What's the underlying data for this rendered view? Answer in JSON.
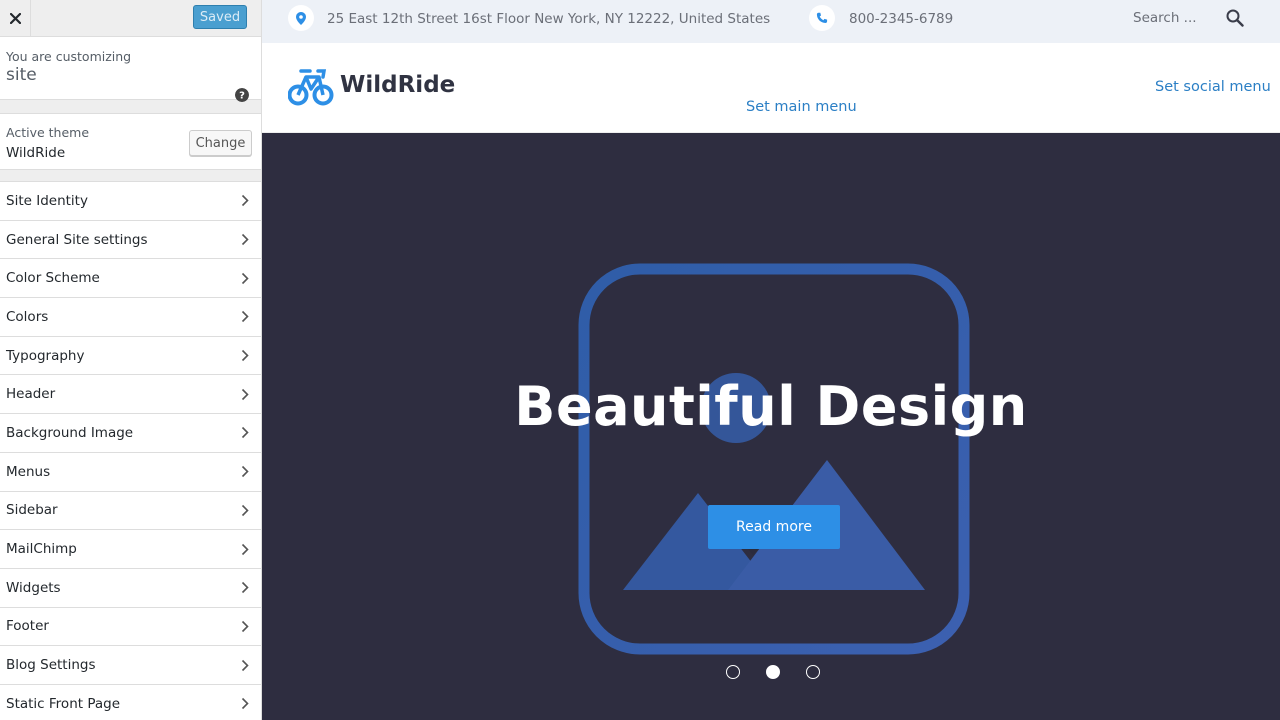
{
  "customizer": {
    "saved_label": "Saved",
    "customizing_label": "You are customizing",
    "customizing_target": "site",
    "active_theme_label": "Active theme",
    "active_theme_name": "WildRide",
    "change_label": "Change",
    "sections": [
      {
        "label": "Site Identity"
      },
      {
        "label": "General Site settings"
      },
      {
        "label": "Color Scheme"
      },
      {
        "label": "Colors"
      },
      {
        "label": "Typography"
      },
      {
        "label": "Header"
      },
      {
        "label": "Background Image"
      },
      {
        "label": "Menus"
      },
      {
        "label": "Sidebar"
      },
      {
        "label": "MailChimp"
      },
      {
        "label": "Widgets"
      },
      {
        "label": "Footer"
      },
      {
        "label": "Blog Settings"
      },
      {
        "label": "Static Front Page"
      }
    ]
  },
  "site": {
    "address": "25 East 12th Street 16st Floor New York, NY 12222, United States",
    "phone": "800-2345-6789",
    "search_placeholder": "Search ...",
    "logo_text": "WildRide",
    "main_menu_link": "Set main menu",
    "social_menu_link": "Set social menu",
    "hero_title": "Beautiful Design",
    "hero_button": "Read more",
    "slider_active_index": 1,
    "slider_count": 3
  },
  "colors": {
    "accent": "#2d8fe6",
    "hero_bg": "#2e2d40",
    "link": "#2b7fc5",
    "saved_button": "#4a9fd0"
  },
  "icons": {
    "close": "close-icon",
    "help": "help-icon",
    "chevron": "chevron-right-icon",
    "pin": "map-pin-icon",
    "phone": "phone-icon",
    "search": "search-icon",
    "logo": "bicycle-logo-icon"
  }
}
